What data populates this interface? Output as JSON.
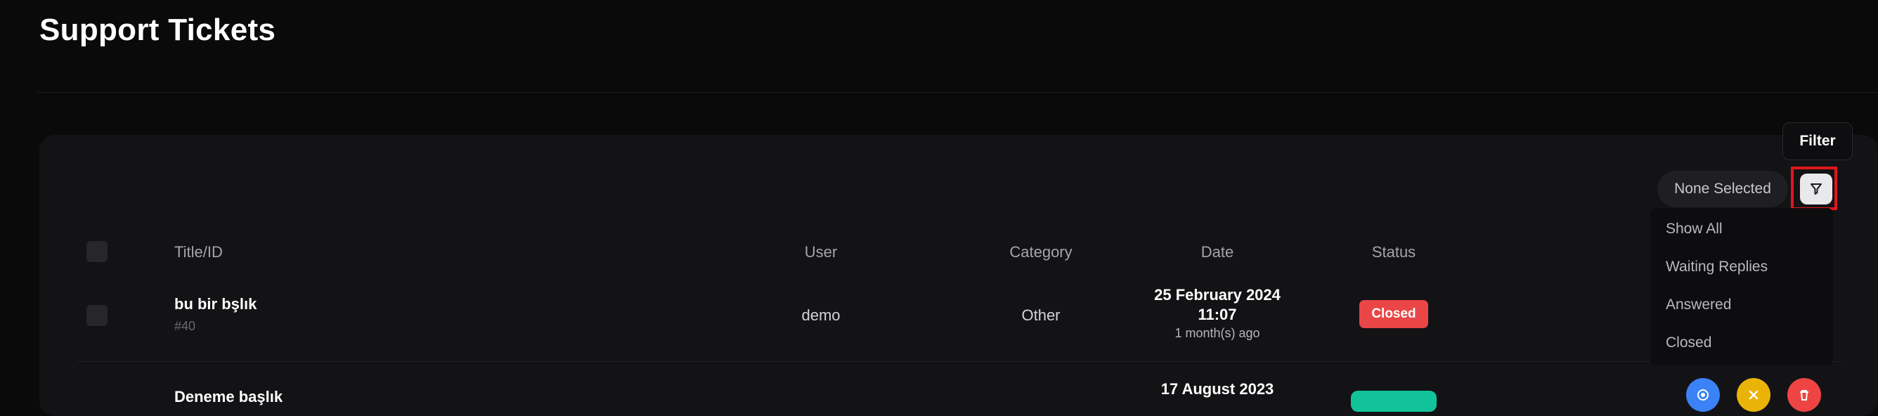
{
  "page": {
    "title": "Support Tickets"
  },
  "filter": {
    "tooltip": "Filter",
    "selected": "None Selected",
    "options": [
      "Show All",
      "Waiting Replies",
      "Answered",
      "Closed"
    ]
  },
  "table": {
    "columns": [
      "Title/ID",
      "User",
      "Category",
      "Date",
      "Status"
    ],
    "rows": [
      {
        "title": "bu bir bşlık",
        "id": "#40",
        "user": "demo",
        "category": "Other",
        "date": "25 February 2024",
        "time": "11:07",
        "ago": "1 month(s) ago",
        "status": "Closed"
      },
      {
        "title": "Deneme başlık",
        "date": "17 August 2023"
      }
    ]
  },
  "colors": {
    "background": "#0a0a0b",
    "card": "#131316",
    "closed_badge": "#ea4648",
    "answered_badge": "#12c39a",
    "highlight": "#e0161b"
  }
}
